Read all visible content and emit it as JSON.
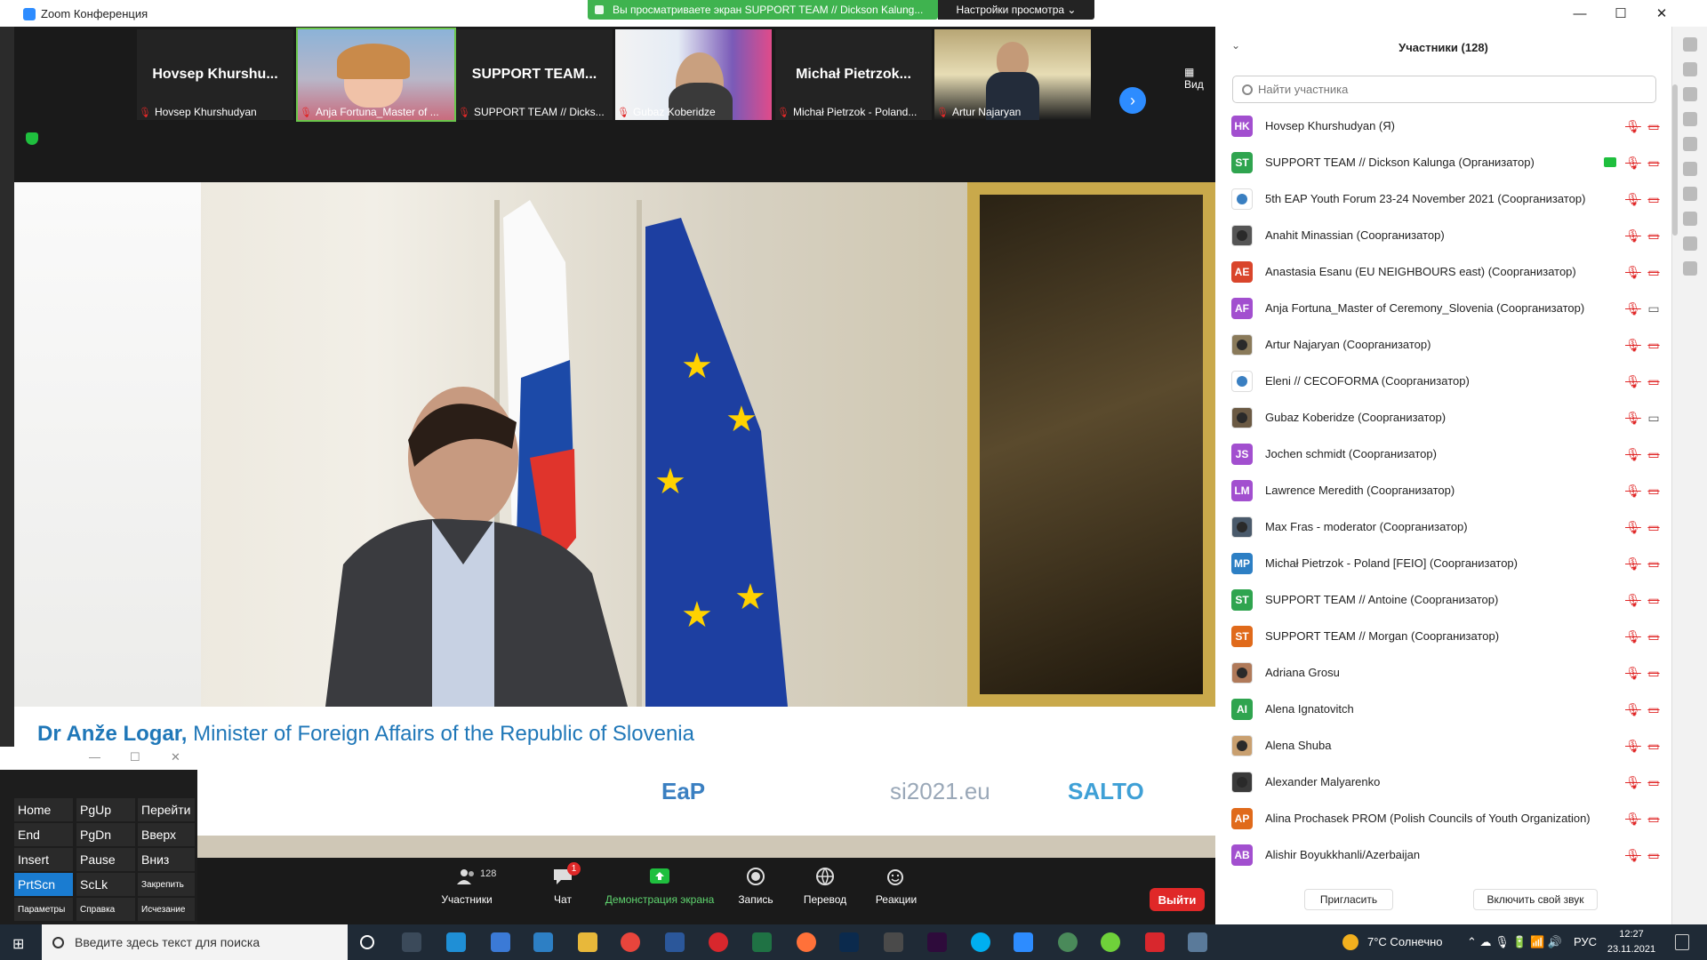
{
  "window": {
    "title": "Zoom Конференция",
    "share_banner": "Вы просматриваете экран SUPPORT TEAM // Dickson Kalung...",
    "view_settings": "Настройки просмотра ⌄",
    "minimize": "—",
    "maximize": "☐",
    "close": "✕"
  },
  "gallery": {
    "view_label": "Вид",
    "next_icon": "chevron-right-icon",
    "tiles": [
      {
        "big_name": "Hovsep  Khurshu...",
        "label": "Hovsep Khurshudyan",
        "has_video": false
      },
      {
        "big_name": "",
        "label": "Anja Fortuna_Master of ...",
        "has_video": true,
        "active": true
      },
      {
        "big_name": "SUPPORT  TEAM...",
        "label": "SUPPORT TEAM // Dicks...",
        "has_video": false
      },
      {
        "big_name": "",
        "label": "Gubaz Koberidze",
        "has_video": true
      },
      {
        "big_name": "Michał  Pietrzok...",
        "label": "Michał Pietrzok - Poland...",
        "has_video": false
      },
      {
        "big_name": "",
        "label": "Artur Najaryan",
        "has_video": true
      }
    ]
  },
  "main_video": {
    "speaker_name": "Dr Anže Logar,",
    "speaker_title": " Minister of Foreign Affairs of the Republic of Slovenia",
    "logos": [
      "EaP",
      "si2021.eu",
      "SALTO"
    ]
  },
  "toolbar": {
    "participants_label": "Участники",
    "participants_count": "128",
    "chat_label": "Чат",
    "chat_badge": "1",
    "share_label": "Демонстрация экрана",
    "record_label": "Запись",
    "translate_label": "Перевод",
    "reactions_label": "Реакции",
    "leave_label": "Выйти"
  },
  "panel": {
    "title": "Участники (128)",
    "search_placeholder": "Найти участника",
    "invite_label": "Пригласить",
    "unmute_label": "Включить свой звук",
    "participants": [
      {
        "initials": "HK",
        "color": "#a24fcf",
        "name": "Hovsep Khurshudyan (Я)",
        "cam_on": false
      },
      {
        "initials": "ST",
        "color": "#2fa44f",
        "name": "SUPPORT TEAM // Dickson Kalunga (Организатор)",
        "cam_on": false,
        "sharing": true
      },
      {
        "initials": "",
        "color": "#ffffff",
        "name": "5th EAP  Youth Forum 23-24 November 2021 (Соорганизатор)",
        "cam_on": false,
        "photo": "logo"
      },
      {
        "initials": "",
        "color": "#555555",
        "name": "Anahit Minassian (Соорганизатор)",
        "cam_on": false,
        "photo": "bw"
      },
      {
        "initials": "AE",
        "color": "#d9452b",
        "name": "Anastasia Esanu (EU NEIGHBOURS east) (Соорганизатор)",
        "cam_on": false
      },
      {
        "initials": "AF",
        "color": "#a24fcf",
        "name": "Anja Fortuna_Master of Ceremony_Slovenia (Соорганизатор)",
        "cam_on": true
      },
      {
        "initials": "",
        "color": "#8a7a5a",
        "name": "Artur Najaryan (Соорганизатор)",
        "cam_on": false,
        "photo": "man"
      },
      {
        "initials": "",
        "color": "#ffffff",
        "name": "Eleni // CECOFORMA (Соорганизатор)",
        "cam_on": false,
        "photo": "logo"
      },
      {
        "initials": "",
        "color": "#6b5a44",
        "name": "Gubaz Koberidze (Соорганизатор)",
        "cam_on": true,
        "photo": "man"
      },
      {
        "initials": "JS",
        "color": "#a24fcf",
        "name": "Jochen schmidt (Соорганизатор)",
        "cam_on": false
      },
      {
        "initials": "LM",
        "color": "#a24fcf",
        "name": "Lawrence Meredith (Соорганизатор)",
        "cam_on": false
      },
      {
        "initials": "",
        "color": "#4a5a6b",
        "name": "Max Fras - moderator (Соорганизатор)",
        "cam_on": false,
        "photo": "man"
      },
      {
        "initials": "MP",
        "color": "#2d7fc4",
        "name": "Michał Pietrzok - Poland [FEIO] (Соорганизатор)",
        "cam_on": false
      },
      {
        "initials": "ST",
        "color": "#2fa44f",
        "name": "SUPPORT TEAM // Antoine (Соорганизатор)",
        "cam_on": false
      },
      {
        "initials": "ST",
        "color": "#e06a1b",
        "name": "SUPPORT TEAM // Morgan (Соорганизатор)",
        "cam_on": false
      },
      {
        "initials": "",
        "color": "#b07a5a",
        "name": "Adriana Grosu",
        "cam_on": false,
        "photo": "woman"
      },
      {
        "initials": "AI",
        "color": "#2fa44f",
        "name": "Alena Ignatovitch",
        "cam_on": false
      },
      {
        "initials": "",
        "color": "#c9a070",
        "name": "Alena Shuba",
        "cam_on": false,
        "photo": "woman"
      },
      {
        "initials": "",
        "color": "#3a3a3a",
        "name": "Alexander Malyarenko",
        "cam_on": false,
        "photo": "man"
      },
      {
        "initials": "AP",
        "color": "#e06a1b",
        "name": "Alina Prochasek PROM (Polish Councils of Youth Organization)",
        "cam_on": false
      },
      {
        "initials": "AB",
        "color": "#a24fcf",
        "name": "Alishir Boyukkhanli/Azerbaijan",
        "cam_on": false
      }
    ]
  },
  "onscreen_keyboard": {
    "keys": [
      [
        "Home",
        "PgUp",
        "Перейти"
      ],
      [
        "End",
        "PgDn",
        "Вверх"
      ],
      [
        "Insert",
        "Pause",
        "Вниз"
      ],
      [
        "PrtScn",
        "ScLk",
        "Закрепить"
      ],
      [
        "Параметры",
        "Справка",
        "Исчезание"
      ]
    ]
  },
  "taskbar": {
    "search_placeholder": "Введите здесь текст для поиска",
    "weather": "7°C  Солнечно",
    "language": "РУС",
    "time": "12:27",
    "date": "23.11.2021"
  }
}
